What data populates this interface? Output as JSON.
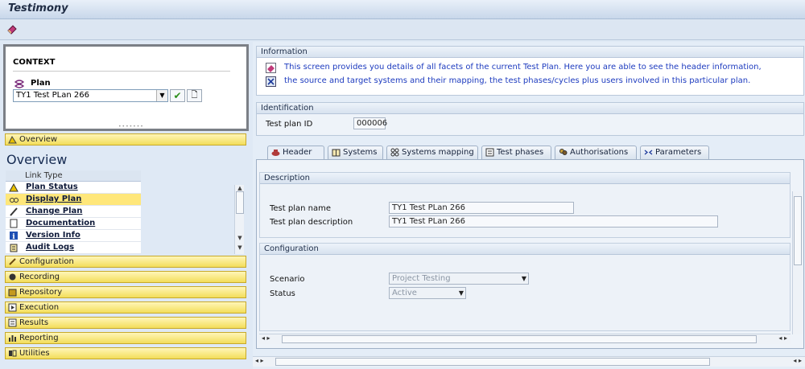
{
  "window": {
    "title": "Testimony"
  },
  "context": {
    "title": "CONTEXT",
    "plan_label": "Plan",
    "plan_value": "TY1 Test PLan 266"
  },
  "left_nav": {
    "overview_bar": "Overview",
    "overview_heading": "Overview",
    "link_type_header": "Link Type",
    "links": [
      {
        "label": "Plan Status",
        "icon": "traffic-light-icon"
      },
      {
        "label": "Display Plan",
        "icon": "glasses-icon"
      },
      {
        "label": "Change Plan",
        "icon": "pencil-icon"
      },
      {
        "label": "Documentation",
        "icon": "document-icon"
      },
      {
        "label": "Version Info",
        "icon": "info-icon"
      },
      {
        "label": "Audit Logs",
        "icon": "log-icon"
      }
    ],
    "sections": [
      {
        "label": "Configuration",
        "icon": "wrench-icon"
      },
      {
        "label": "Recording",
        "icon": "recording-icon"
      },
      {
        "label": "Repository",
        "icon": "repository-icon"
      },
      {
        "label": "Execution",
        "icon": "execution-icon"
      },
      {
        "label": "Results",
        "icon": "results-icon"
      },
      {
        "label": "Reporting",
        "icon": "reporting-icon"
      },
      {
        "label": "Utilities",
        "icon": "utilities-icon"
      }
    ]
  },
  "information": {
    "title": "Information",
    "line1": "This screen provides you details of all facets of the current Test Plan. Here you are able to see the header information,",
    "line2": "the source and target systems and their mapping, the test phases/cycles plus users involved in this particular plan."
  },
  "identification": {
    "title": "Identification",
    "plan_id_label": "Test plan ID",
    "plan_id_value": "000006"
  },
  "tabs": [
    {
      "label": "Header",
      "icon": "header-icon"
    },
    {
      "label": "Systems",
      "icon": "book-icon"
    },
    {
      "label": "Systems mapping",
      "icon": "mapping-icon"
    },
    {
      "label": "Test phases",
      "icon": "list-icon"
    },
    {
      "label": "Authorisations",
      "icon": "users-icon"
    },
    {
      "label": "Parameters",
      "icon": "parameters-icon"
    }
  ],
  "description": {
    "title": "Description",
    "name_label": "Test plan name",
    "name_value": "TY1 Test PLan 266",
    "desc_label": "Test plan description",
    "desc_value": "TY1 Test PLan 266"
  },
  "configuration": {
    "title": "Configuration",
    "scenario_label": "Scenario",
    "scenario_value": "Project Testing",
    "status_label": "Status",
    "status_value": "Active"
  },
  "colors": {
    "nav_bar": "#f3dd5a",
    "info_text": "#1d3bbf",
    "selected_row": "#ffe77a"
  }
}
